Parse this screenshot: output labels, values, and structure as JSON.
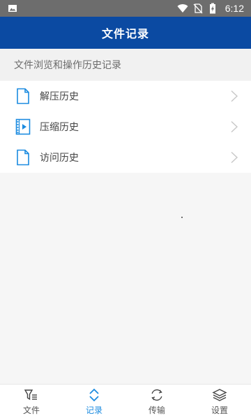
{
  "status_bar": {
    "time": "6:12",
    "icons": [
      "image-icon",
      "wifi-icon",
      "no-sim-icon",
      "battery-charging-icon"
    ]
  },
  "header": {
    "title": "文件记录"
  },
  "section": {
    "title": "文件浏览和操作历史记录"
  },
  "list": {
    "items": [
      {
        "label": "解压历史",
        "icon": "document-icon"
      },
      {
        "label": "压缩历史",
        "icon": "video-file-icon"
      },
      {
        "label": "访问历史",
        "icon": "document-icon"
      }
    ]
  },
  "tabs": [
    {
      "label": "文件",
      "icon": "filter-list-icon",
      "active": false
    },
    {
      "label": "记录",
      "icon": "updown-arrows-icon",
      "active": true
    },
    {
      "label": "传输",
      "icon": "sync-icon",
      "active": false
    },
    {
      "label": "设置",
      "icon": "layers-icon",
      "active": false
    }
  ],
  "colors": {
    "primary": "#0b4aa2",
    "accent": "#1b8be0",
    "status_bar": "#6d6d6d",
    "section_bg": "#f1f1f1",
    "page_bg": "#f6f6f6"
  }
}
